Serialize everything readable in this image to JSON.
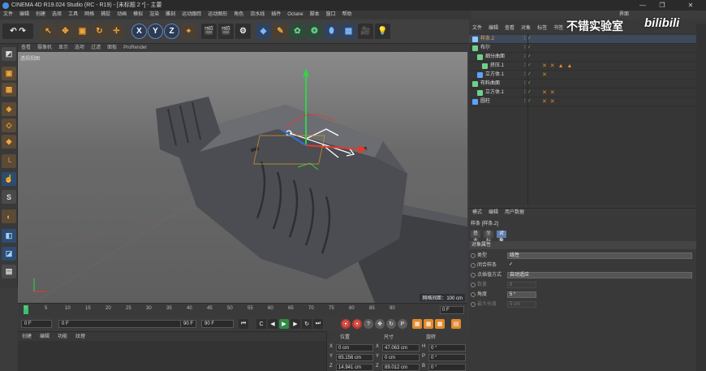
{
  "window": {
    "title": "CINEMA 4D R19.024 Studio (RC - R19) - [未标题 2 *] - 主要",
    "controls": [
      "—",
      "❐",
      "✕"
    ]
  },
  "menubar": [
    "文件",
    "编辑",
    "创建",
    "选择",
    "工具",
    "网格",
    "捕捉",
    "动画",
    "模拟",
    "渲染",
    "雕刻",
    "运动跟踪",
    "运动图形",
    "角色",
    "流水线",
    "插件",
    "Octane",
    "脚本",
    "窗口",
    "帮助"
  ],
  "layout_label": "界面",
  "watermark": {
    "channel": "不错实验室",
    "logo": "bilibili"
  },
  "viewport": {
    "menu": [
      "查看",
      "摄像机",
      "显示",
      "选项",
      "过滤",
      "面板",
      "ProRender"
    ],
    "label": "透视视图",
    "status": "网格间距：100 cm"
  },
  "timeline": {
    "ticks": [
      "0",
      "5",
      "10",
      "15",
      "20",
      "25",
      "30",
      "35",
      "40",
      "45",
      "50",
      "55",
      "60",
      "65",
      "70",
      "75",
      "80",
      "85",
      "90"
    ],
    "current_frame": "0 F"
  },
  "transport": {
    "start": "0 F",
    "current": "0 F",
    "end": "90 F",
    "preview_end": "90 F"
  },
  "material_menu": [
    "创建",
    "编辑",
    "功能",
    "纹理"
  ],
  "coordinates": {
    "headers": [
      "位置",
      "尺寸",
      "旋转"
    ],
    "rows": [
      {
        "axis": "X",
        "pos": "0 cm",
        "size_axis": "X",
        "size": "47.063 cm",
        "rot_axis": "H",
        "rot": "0 °"
      },
      {
        "axis": "Y",
        "pos": "65.156 cm",
        "size_axis": "Y",
        "size": "0 cm",
        "rot_axis": "P",
        "rot": "0 °"
      },
      {
        "axis": "Z",
        "pos": "14.941 cm",
        "size_axis": "Z",
        "size": "89.012 cm",
        "rot_axis": "B",
        "rot": "0 °"
      }
    ]
  },
  "object_manager": {
    "menu": [
      "文件",
      "编辑",
      "查看",
      "对象",
      "标签",
      "书签"
    ],
    "objects": [
      {
        "name": "样条.2",
        "indent": 0,
        "icon": "spline",
        "tags": "",
        "selected": true
      },
      {
        "name": "布尔",
        "indent": 0,
        "icon": "boole",
        "tags": "",
        "selected": false
      },
      {
        "name": "细分曲面",
        "indent": 1,
        "icon": "subdiv",
        "tags": "",
        "selected": false
      },
      {
        "name": "挤压.1",
        "indent": 2,
        "icon": "extrude",
        "tags": "✕ ✕ ▲ ▲",
        "selected": false
      },
      {
        "name": "立方体.1",
        "indent": 1,
        "icon": "cube",
        "tags": "✕",
        "selected": false
      },
      {
        "name": "布料曲面",
        "indent": 0,
        "icon": "cloth",
        "tags": "",
        "selected": false
      },
      {
        "name": "立方体.1",
        "indent": 1,
        "icon": "extrude",
        "tags": "✕ ✕",
        "selected": false
      },
      {
        "name": "圆柱",
        "indent": 0,
        "icon": "cylinder",
        "tags": "✕ ✕",
        "selected": false
      }
    ]
  },
  "attributes": {
    "menu": [
      "模式",
      "编辑",
      "用户数据"
    ],
    "object": "样条 [样条.2]",
    "tabs": [
      "基本",
      "坐标",
      "对象"
    ],
    "active_tab": "对象",
    "section": "对象属性",
    "rows": [
      {
        "label": "类型",
        "value": "线性",
        "dim": false,
        "kind": "select"
      },
      {
        "label": "闭合样条",
        "value": "✓",
        "dim": false,
        "kind": "check"
      },
      {
        "label": "点插值方式",
        "value": "自动适应",
        "dim": false,
        "kind": "select"
      },
      {
        "label": "数量",
        "value": "8",
        "dim": true,
        "kind": "field"
      },
      {
        "label": "角度",
        "value": "5 °",
        "dim": false,
        "kind": "field"
      },
      {
        "label": "最大长度",
        "value": "5 cm",
        "dim": true,
        "kind": "field"
      }
    ]
  },
  "colors": {
    "accent_orange": "#f2a63c",
    "accent_blue": "#5c7fae",
    "play_green": "#39c46a",
    "record_red": "#c4382e"
  }
}
